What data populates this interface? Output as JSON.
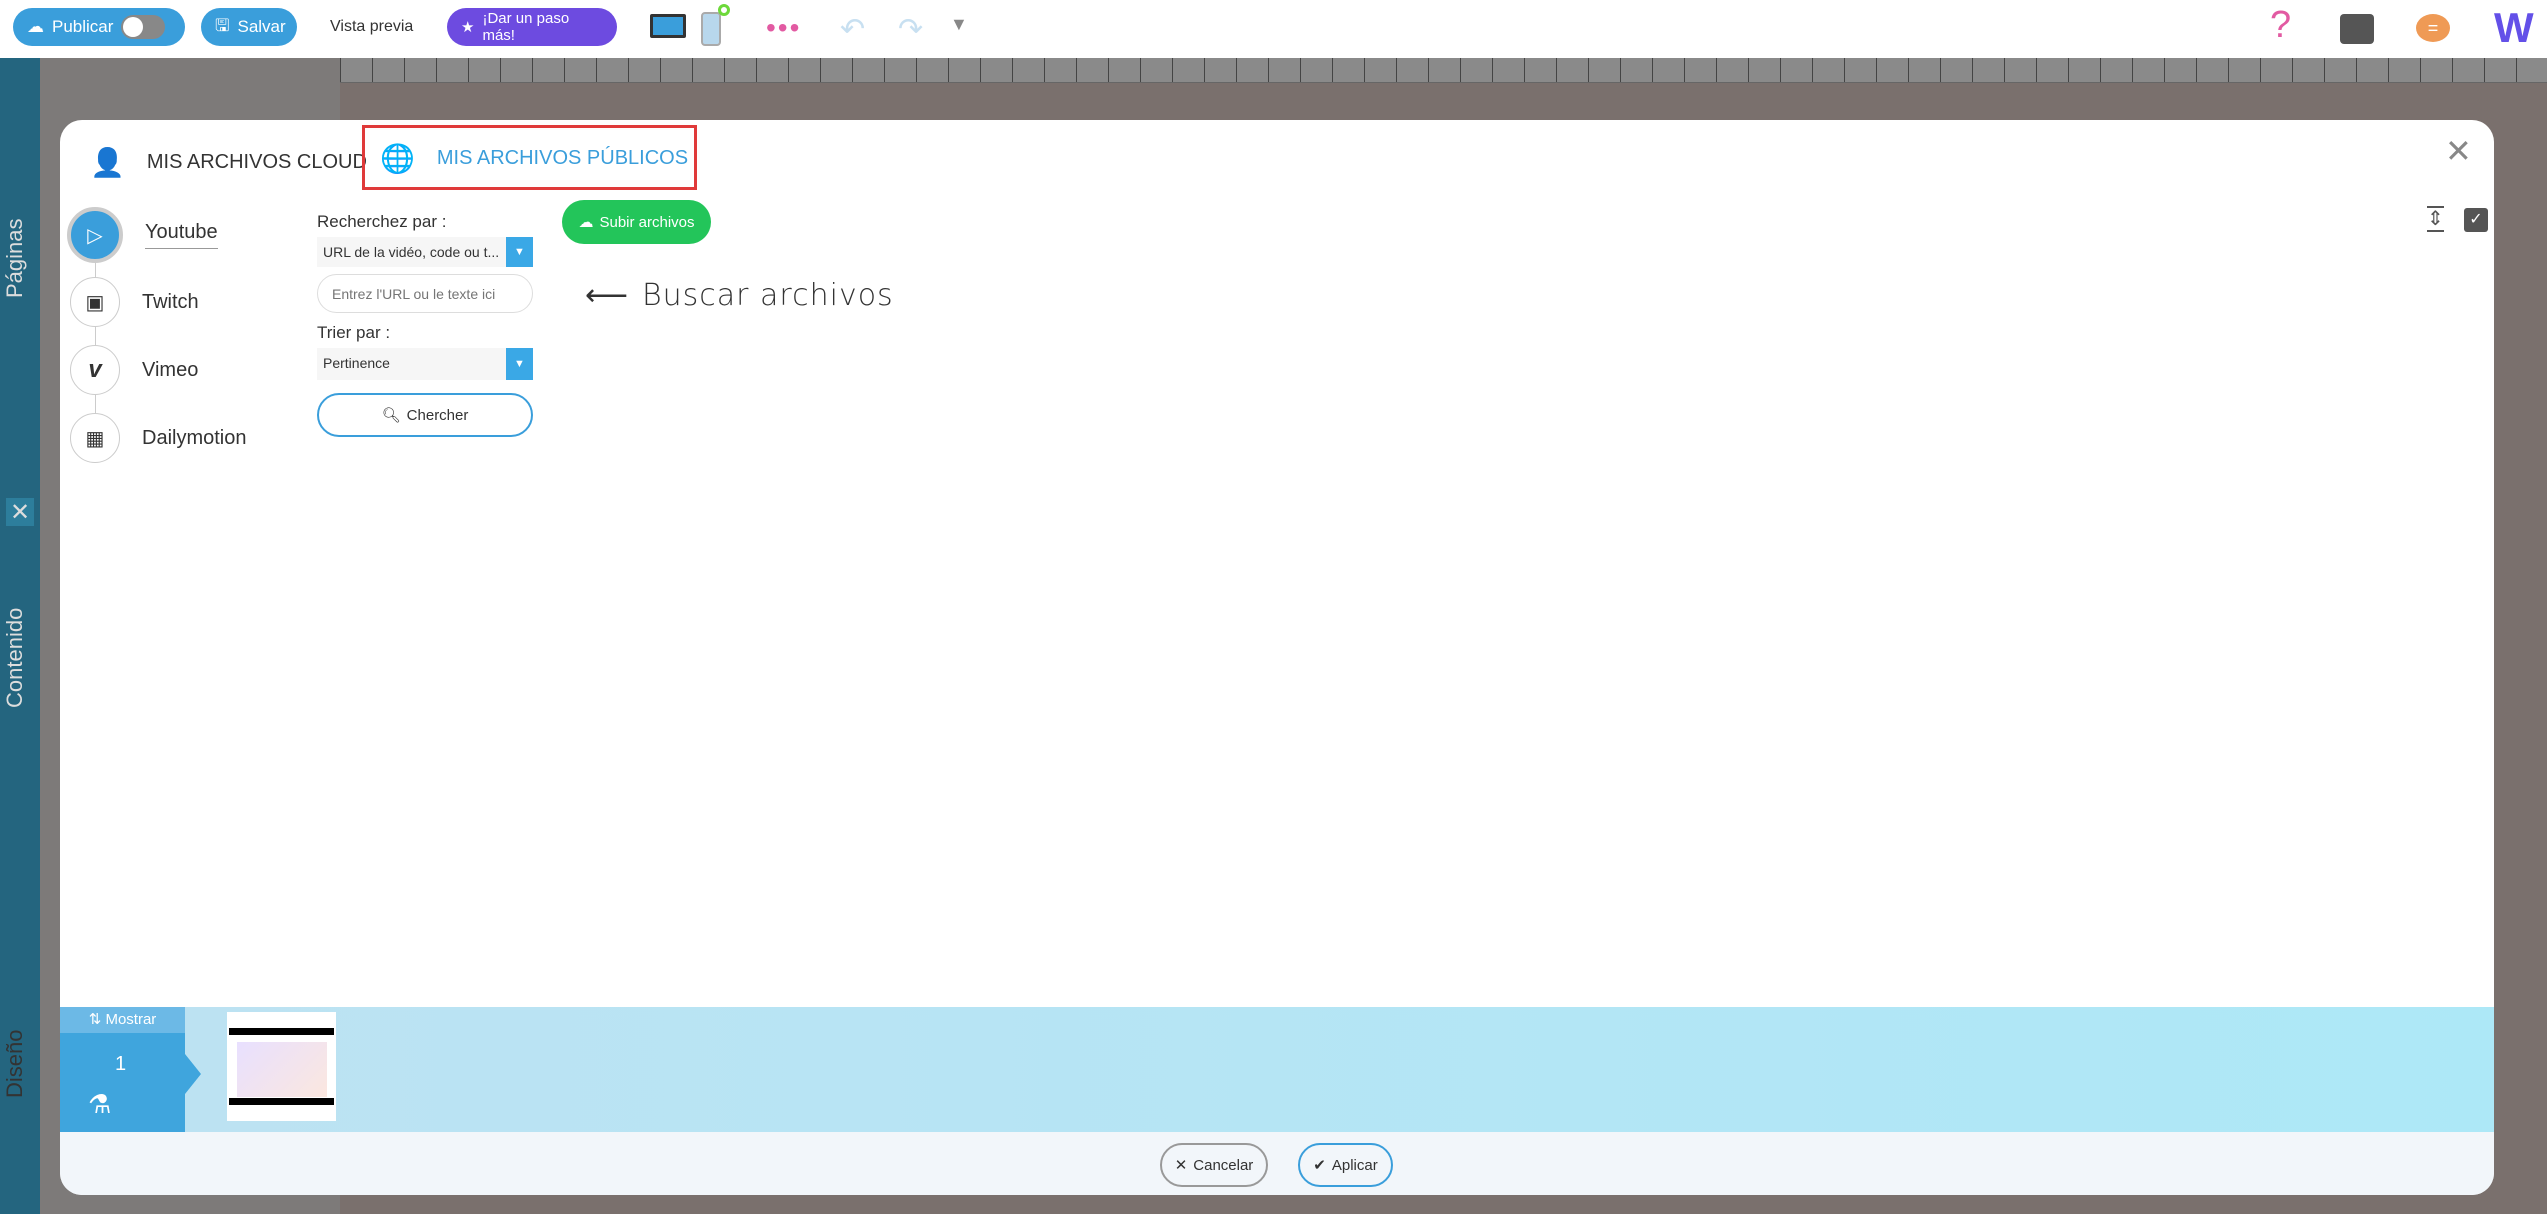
{
  "topbar": {
    "publish": "Publicar",
    "save": "Salvar",
    "preview": "Vista previa",
    "upgrade": "¡Dar un paso más!"
  },
  "sidebar": {
    "pages": "Páginas",
    "content": "Contenido",
    "design": "Diseño"
  },
  "modal": {
    "tabs": [
      {
        "label": "MIS ARCHIVOS CLOUD",
        "active": false
      },
      {
        "label": "MIS ARCHIVOS PÚBLICOS",
        "active": true
      }
    ],
    "sources": [
      {
        "label": "Youtube",
        "active": true
      },
      {
        "label": "Twitch"
      },
      {
        "label": "Vimeo"
      },
      {
        "label": "Dailymotion"
      }
    ],
    "search_by_label": "Recherchez par :",
    "search_by_value": "URL de la vidéo, code ou t...",
    "search_placeholder": "Entrez l'URL ou le texte ici",
    "sort_label": "Trier par :",
    "sort_value": "Pertinence",
    "search_button": "Chercher",
    "upload_button": "Subir archivos",
    "annotation": "Buscar archivos",
    "strip": {
      "toggle": "Mostrar",
      "page_number": "1"
    },
    "cancel": "Cancelar",
    "apply": "Aplicar"
  },
  "colors": {
    "accent": "#3a9edb",
    "upload": "#23c55a",
    "highlight": "#e03a3a",
    "purple": "#6d4be0"
  }
}
